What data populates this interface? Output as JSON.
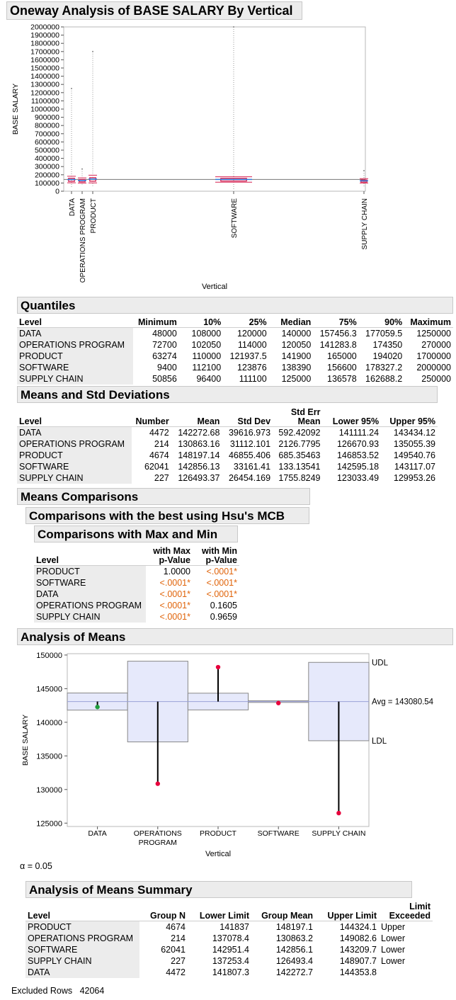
{
  "report": {
    "title": "Oneway Analysis of BASE SALARY By Vertical",
    "excluded_label": "Excluded Rows",
    "excluded_value": "42064",
    "alpha_text": "α = 0.05"
  },
  "oneway": {
    "ylabel": "BASE SALARY",
    "xlabel": "Vertical",
    "yticks": [
      "2000000",
      "1900000",
      "1800000",
      "1700000",
      "1600000",
      "1500000",
      "1400000",
      "1300000",
      "1200000",
      "1100000",
      "1000000",
      "900000",
      "800000",
      "700000",
      "600000",
      "500000",
      "400000",
      "300000",
      "200000",
      "100000",
      "0"
    ],
    "categories": [
      "DATA",
      "OPERATIONS PROGRAM",
      "PRODUCT",
      "SOFTWARE",
      "SUPPLY CHAIN"
    ]
  },
  "quantiles": {
    "title": "Quantiles",
    "columns": [
      "Level",
      "Minimum",
      "10%",
      "25%",
      "Median",
      "75%",
      "90%",
      "Maximum"
    ],
    "rows": [
      [
        "DATA",
        "48000",
        "108000",
        "120000",
        "140000",
        "157456.3",
        "177059.5",
        "1250000"
      ],
      [
        "OPERATIONS PROGRAM",
        "72700",
        "102050",
        "114000",
        "120050",
        "141283.8",
        "174350",
        "270000"
      ],
      [
        "PRODUCT",
        "63274",
        "110000",
        "121937.5",
        "141900",
        "165000",
        "194020",
        "1700000"
      ],
      [
        "SOFTWARE",
        "9400",
        "112100",
        "123876",
        "138390",
        "156600",
        "178327.2",
        "2000000"
      ],
      [
        "SUPPLY CHAIN",
        "50856",
        "96400",
        "111100",
        "125000",
        "136578",
        "162688.2",
        "250000"
      ]
    ]
  },
  "means": {
    "title": "Means and Std Deviations",
    "columns": [
      "Level",
      "Number",
      "Mean",
      "Std Dev",
      "Std Err Mean",
      "Lower 95%",
      "Upper 95%"
    ],
    "rows": [
      [
        "DATA",
        "4472",
        "142272.68",
        "39616.973",
        "592.42092",
        "141111.24",
        "143434.12"
      ],
      [
        "OPERATIONS PROGRAM",
        "214",
        "130863.16",
        "31112.101",
        "2126.7795",
        "126670.93",
        "135055.39"
      ],
      [
        "PRODUCT",
        "4674",
        "148197.14",
        "46855.406",
        "685.35463",
        "146853.52",
        "149540.76"
      ],
      [
        "SOFTWARE",
        "62041",
        "142856.13",
        "33161.41",
        "133.13541",
        "142595.18",
        "143117.07"
      ],
      [
        "SUPPLY CHAIN",
        "227",
        "126493.37",
        "26454.169",
        "1755.8249",
        "123033.49",
        "129953.26"
      ]
    ]
  },
  "comparisons": {
    "title": "Means Comparisons",
    "subtitle": "Comparisons with the best using Hsu's MCB",
    "subsubtitle": "Comparisons with Max and Min",
    "columns": [
      "Level",
      "with Max p-Value",
      "with Min p-Value"
    ],
    "col_max_1": "with Max",
    "col_max_2": "p-Value",
    "col_min_1": "with Min",
    "col_min_2": "p-Value",
    "rows": [
      [
        "PRODUCT",
        "1.0000",
        "<.0001*"
      ],
      [
        "SOFTWARE",
        "<.0001*",
        "<.0001*"
      ],
      [
        "DATA",
        "<.0001*",
        "<.0001*"
      ],
      [
        "OPERATIONS PROGRAM",
        "<.0001*",
        "0.1605"
      ],
      [
        "SUPPLY CHAIN",
        "<.0001*",
        "0.9659"
      ]
    ],
    "highlight_color": "#e0640a"
  },
  "anom": {
    "title": "Analysis of Means",
    "ylabel": "BASE SALARY",
    "xlabel": "Vertical",
    "udl_label": "UDL",
    "ldl_label": "LDL",
    "avg_label": "Avg = 143080.54"
  },
  "anom_summary": {
    "title": "Analysis of Means Summary",
    "columns": [
      "Level",
      "Group N",
      "Lower Limit",
      "Group Mean",
      "Upper Limit",
      "Limit Exceeded"
    ],
    "rows": [
      [
        "PRODUCT",
        "4674",
        "141837",
        "148197.1",
        "144324.1",
        "Upper"
      ],
      [
        "OPERATIONS PROGRAM",
        "214",
        "137078.4",
        "130863.2",
        "149082.6",
        "Lower"
      ],
      [
        "SOFTWARE",
        "62041",
        "142951.4",
        "142856.1",
        "143209.7",
        "Lower"
      ],
      [
        "SUPPLY CHAIN",
        "227",
        "137253.4",
        "126493.4",
        "148907.7",
        "Lower"
      ],
      [
        "DATA",
        "4472",
        "141807.3",
        "142272.7",
        "144353.8",
        ""
      ]
    ]
  },
  "chart_data": [
    {
      "type": "scatter",
      "xlabel": "Vertical",
      "ylabel": "BASE SALARY",
      "ylim": [
        0,
        2000000
      ],
      "categories": [
        "DATA",
        "OPERATIONS PROGRAM",
        "PRODUCT",
        "SOFTWARE",
        "SUPPLY CHAIN"
      ],
      "group_n": [
        4472,
        214,
        4674,
        62041,
        227
      ],
      "means": [
        142272.68,
        130863.16,
        148197.14,
        142856.13,
        126493.37
      ],
      "std_devs": [
        39616.973,
        31112.101,
        46855.406,
        33161.41,
        26454.169
      ],
      "quantiles": {
        "min": [
          48000,
          72700,
          63274,
          9400,
          50856
        ],
        "p25": [
          120000,
          114000,
          121937.5,
          123876,
          111100
        ],
        "median": [
          140000,
          120050,
          141900,
          138390,
          125000
        ],
        "p75": [
          157456.3,
          141283.8,
          165000,
          156600,
          136578
        ],
        "max": [
          1250000,
          270000,
          1700000,
          2000000,
          250000
        ]
      },
      "grand_mean": 143080.54
    },
    {
      "type": "line",
      "title": "",
      "xlabel": "Vertical",
      "ylabel": "BASE SALARY",
      "ylim": [
        124500,
        150200
      ],
      "yticks": [
        125000,
        130000,
        135000,
        140000,
        145000,
        150000
      ],
      "categories": [
        "DATA",
        "OPERATIONS PROGRAM",
        "PRODUCT",
        "SOFTWARE",
        "SUPPLY CHAIN"
      ],
      "category_labels": [
        "DATA",
        "OPERATIONS\nPROGRAM",
        "PRODUCT",
        "SOFTWARE",
        "SUPPLY CHAIN"
      ],
      "group_means": [
        142272.7,
        130863.2,
        148197.1,
        142856.1,
        126493.4
      ],
      "lower_limits": [
        141807.3,
        137078.4,
        141837,
        142951.4,
        137253.4
      ],
      "upper_limits": [
        144353.8,
        149082.6,
        144324.1,
        143209.7,
        148907.7
      ],
      "center": 143080.54,
      "point_colors": [
        "#1e9e3c",
        "#e8003c",
        "#e8003c",
        "#e8003c",
        "#e8003c"
      ]
    }
  ]
}
